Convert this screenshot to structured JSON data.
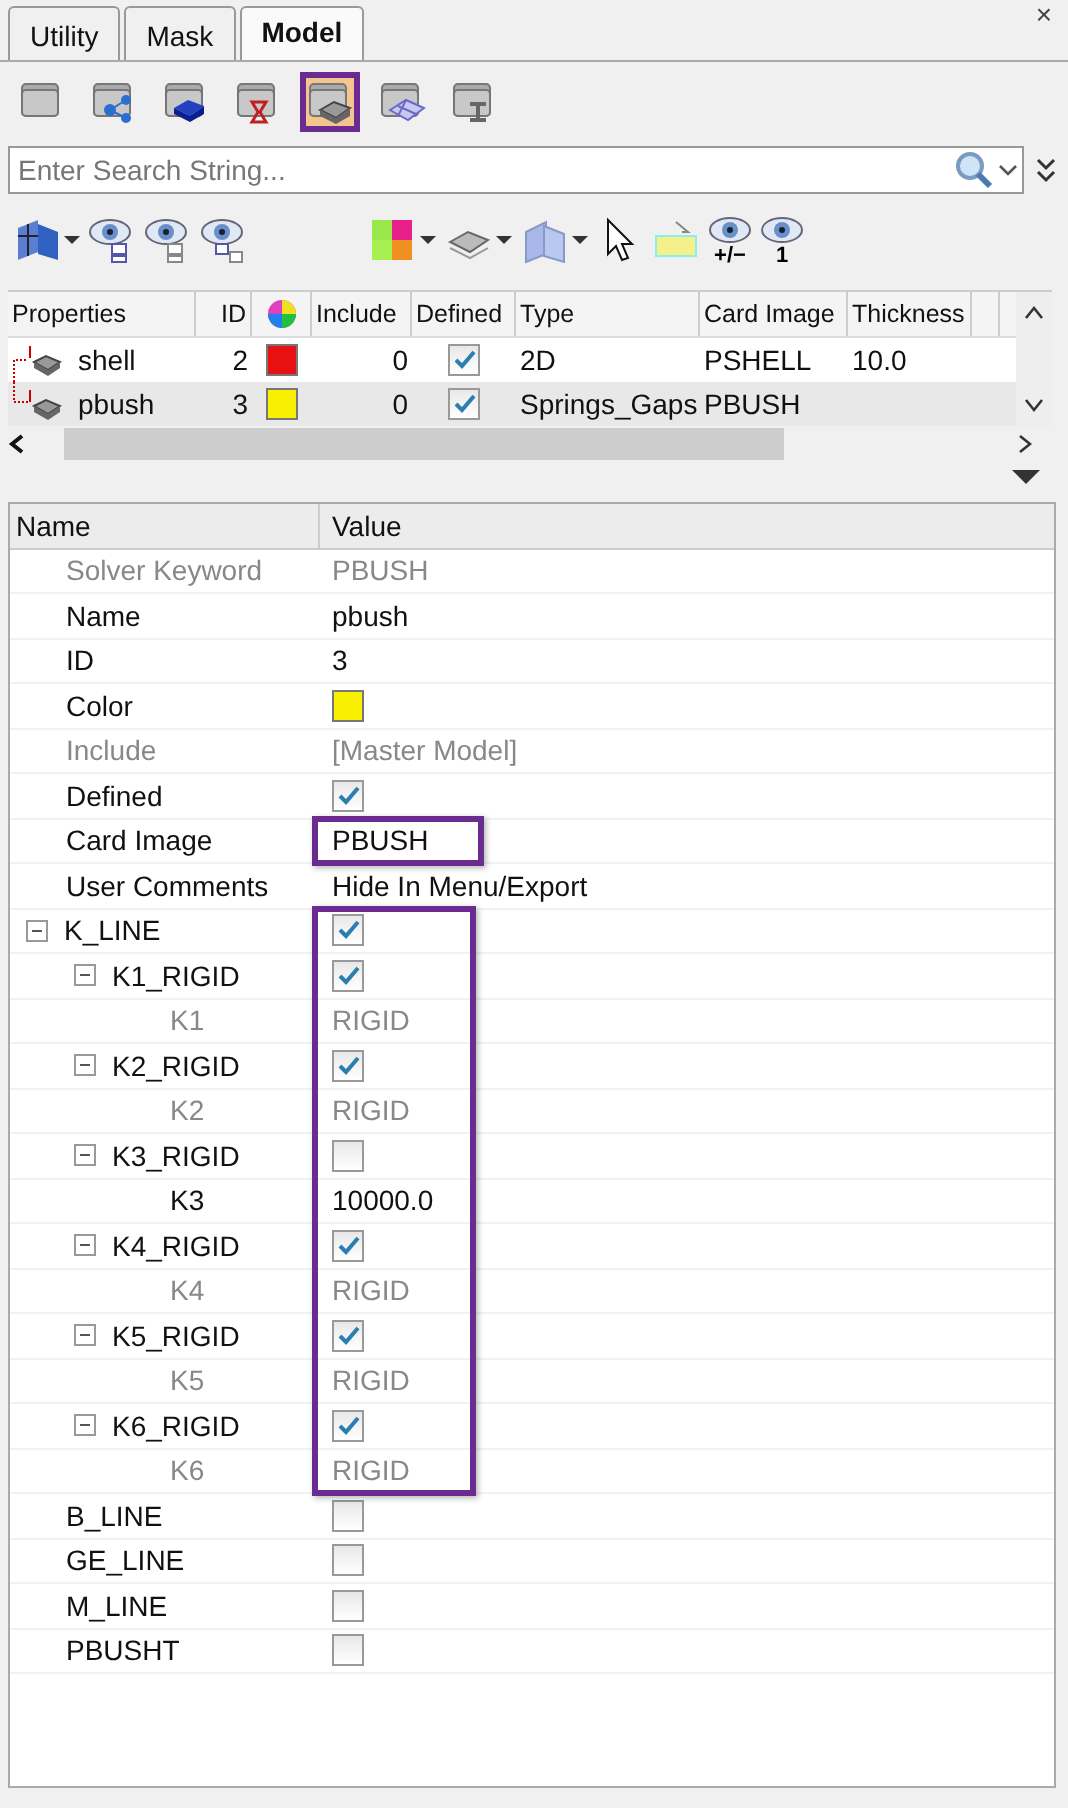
{
  "tabs": [
    {
      "label": "Utility",
      "selected": false
    },
    {
      "label": "Mask",
      "selected": false
    },
    {
      "label": "Model",
      "selected": true
    }
  ],
  "close_label": "×",
  "browser_icons": [
    {
      "kind": "folder",
      "highlighted": false
    },
    {
      "kind": "network",
      "highlighted": false
    },
    {
      "kind": "block",
      "highlighted": false
    },
    {
      "kind": "timer",
      "highlighted": false
    },
    {
      "kind": "property",
      "highlighted": true
    },
    {
      "kind": "mesh",
      "highlighted": false
    },
    {
      "kind": "beam",
      "highlighted": false
    }
  ],
  "search": {
    "placeholder": "Enter Search String..."
  },
  "view_tools": [
    {
      "kind": "parts",
      "dropdown": true
    },
    {
      "kind": "eye-list",
      "dropdown": false
    },
    {
      "kind": "eye-tree",
      "dropdown": false
    },
    {
      "kind": "eye-swap",
      "dropdown": false
    },
    {
      "kind": "palette",
      "dropdown": true
    },
    {
      "kind": "shade",
      "dropdown": true
    },
    {
      "kind": "mesh",
      "dropdown": true
    },
    {
      "kind": "cursor",
      "dropdown": false
    },
    {
      "kind": "highlight",
      "dropdown": false
    },
    {
      "kind": "eye",
      "dropdown": false,
      "caption": "+/−"
    },
    {
      "kind": "eye",
      "dropdown": false,
      "caption": "1"
    }
  ],
  "table": {
    "columns": [
      "Properties",
      "ID",
      "",
      "Include",
      "Defined",
      "Type",
      "Card Image",
      "Thickness",
      ""
    ],
    "rows": [
      {
        "name": "shell",
        "id": "2",
        "color": "#e81010",
        "include": "0",
        "defined": true,
        "type": "2D",
        "card_image": "PSHELL",
        "thickness": "10.0",
        "selected": false
      },
      {
        "name": "pbush",
        "id": "3",
        "color": "#f8f000",
        "include": "0",
        "defined": true,
        "type": "Springs_Gaps",
        "card_image": "PBUSH",
        "thickness": "",
        "selected": true
      }
    ]
  },
  "properties": {
    "columns": [
      "Name",
      "Value"
    ],
    "rows": [
      {
        "name": "Solver Keyword",
        "kind": "text",
        "value": "PBUSH",
        "disabled": true
      },
      {
        "name": "Name",
        "kind": "text",
        "value": "pbush",
        "disabled": false
      },
      {
        "name": "ID",
        "kind": "text",
        "value": "3",
        "disabled": false
      },
      {
        "name": "Color",
        "kind": "color",
        "color": "#f8f000",
        "disabled": false
      },
      {
        "name": "Include",
        "kind": "text",
        "value": "[Master Model]",
        "disabled": true
      },
      {
        "name": "Defined",
        "kind": "checkbox",
        "checked": true,
        "disabled": false
      },
      {
        "name": "Card Image",
        "kind": "text",
        "value": "PBUSH",
        "disabled": false,
        "highlighted": true
      },
      {
        "name": "User Comments",
        "kind": "text",
        "value": "Hide In Menu/Export",
        "disabled": false
      },
      {
        "name": "K_LINE",
        "kind": "checkbox",
        "checked": true,
        "disabled": false,
        "expanded": true,
        "highlighted": true,
        "children": [
          {
            "name": "K1_RIGID",
            "kind": "checkbox",
            "checked": true,
            "disabled": false,
            "expanded": true,
            "children": [
              {
                "name": "K1",
                "kind": "text",
                "value": "RIGID",
                "disabled": true
              }
            ]
          },
          {
            "name": "K2_RIGID",
            "kind": "checkbox",
            "checked": true,
            "disabled": false,
            "expanded": true,
            "children": [
              {
                "name": "K2",
                "kind": "text",
                "value": "RIGID",
                "disabled": true
              }
            ]
          },
          {
            "name": "K3_RIGID",
            "kind": "checkbox",
            "checked": false,
            "disabled": false,
            "expanded": true,
            "children": [
              {
                "name": "K3",
                "kind": "text",
                "value": "10000.0",
                "disabled": false
              }
            ]
          },
          {
            "name": "K4_RIGID",
            "kind": "checkbox",
            "checked": true,
            "disabled": false,
            "expanded": true,
            "children": [
              {
                "name": "K4",
                "kind": "text",
                "value": "RIGID",
                "disabled": true
              }
            ]
          },
          {
            "name": "K5_RIGID",
            "kind": "checkbox",
            "checked": true,
            "disabled": false,
            "expanded": true,
            "children": [
              {
                "name": "K5",
                "kind": "text",
                "value": "RIGID",
                "disabled": true
              }
            ]
          },
          {
            "name": "K6_RIGID",
            "kind": "checkbox",
            "checked": true,
            "disabled": false,
            "expanded": true,
            "children": [
              {
                "name": "K6",
                "kind": "text",
                "value": "RIGID",
                "disabled": true
              }
            ]
          }
        ]
      },
      {
        "name": "B_LINE",
        "kind": "checkbox",
        "checked": false,
        "disabled": false
      },
      {
        "name": "GE_LINE",
        "kind": "checkbox",
        "checked": false,
        "disabled": false
      },
      {
        "name": "M_LINE",
        "kind": "checkbox",
        "checked": false,
        "disabled": false
      },
      {
        "name": "PBUSHT",
        "kind": "checkbox",
        "checked": false,
        "disabled": false
      }
    ]
  }
}
